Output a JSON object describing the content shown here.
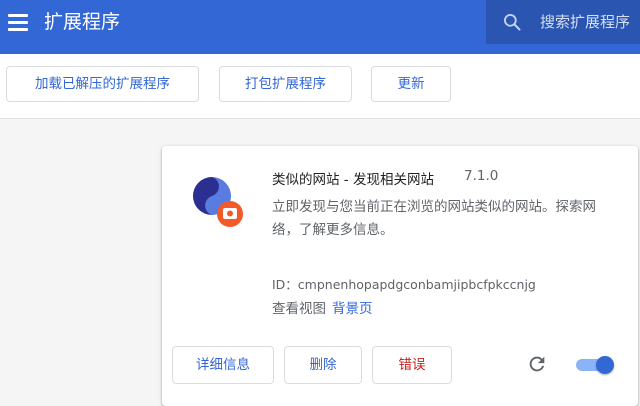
{
  "header": {
    "title": "扩展程序",
    "menu_icon": "hamburger-menu-icon",
    "search_icon": "search-icon",
    "search_placeholder": "搜索扩展程序"
  },
  "toolbar": {
    "load_unpacked_label": "加载已解压的扩展程序",
    "pack_label": "打包扩展程序",
    "update_label": "更新"
  },
  "extension": {
    "name": "类似的网站 - 发现相关网站",
    "version": "7.1.0",
    "description": "立即发现与您当前正在浏览的网站类似的网站。探索网络，了解更多信息。",
    "id_text": "ID：cmpnenhopapdgconbamjipbcfpkccnjg",
    "inspect_views_label": "查看视图",
    "background_page_link": "背景页",
    "details_label": "详细信息",
    "remove_label": "删除",
    "errors_label": "错误",
    "reload_icon": "reload-icon",
    "enabled": true
  },
  "colors": {
    "header_bg": "#3367d6",
    "search_bg": "#2a56b2",
    "accent": "#3367d6",
    "error": "#c5221f",
    "toggle_track": "#8ab4f8"
  }
}
